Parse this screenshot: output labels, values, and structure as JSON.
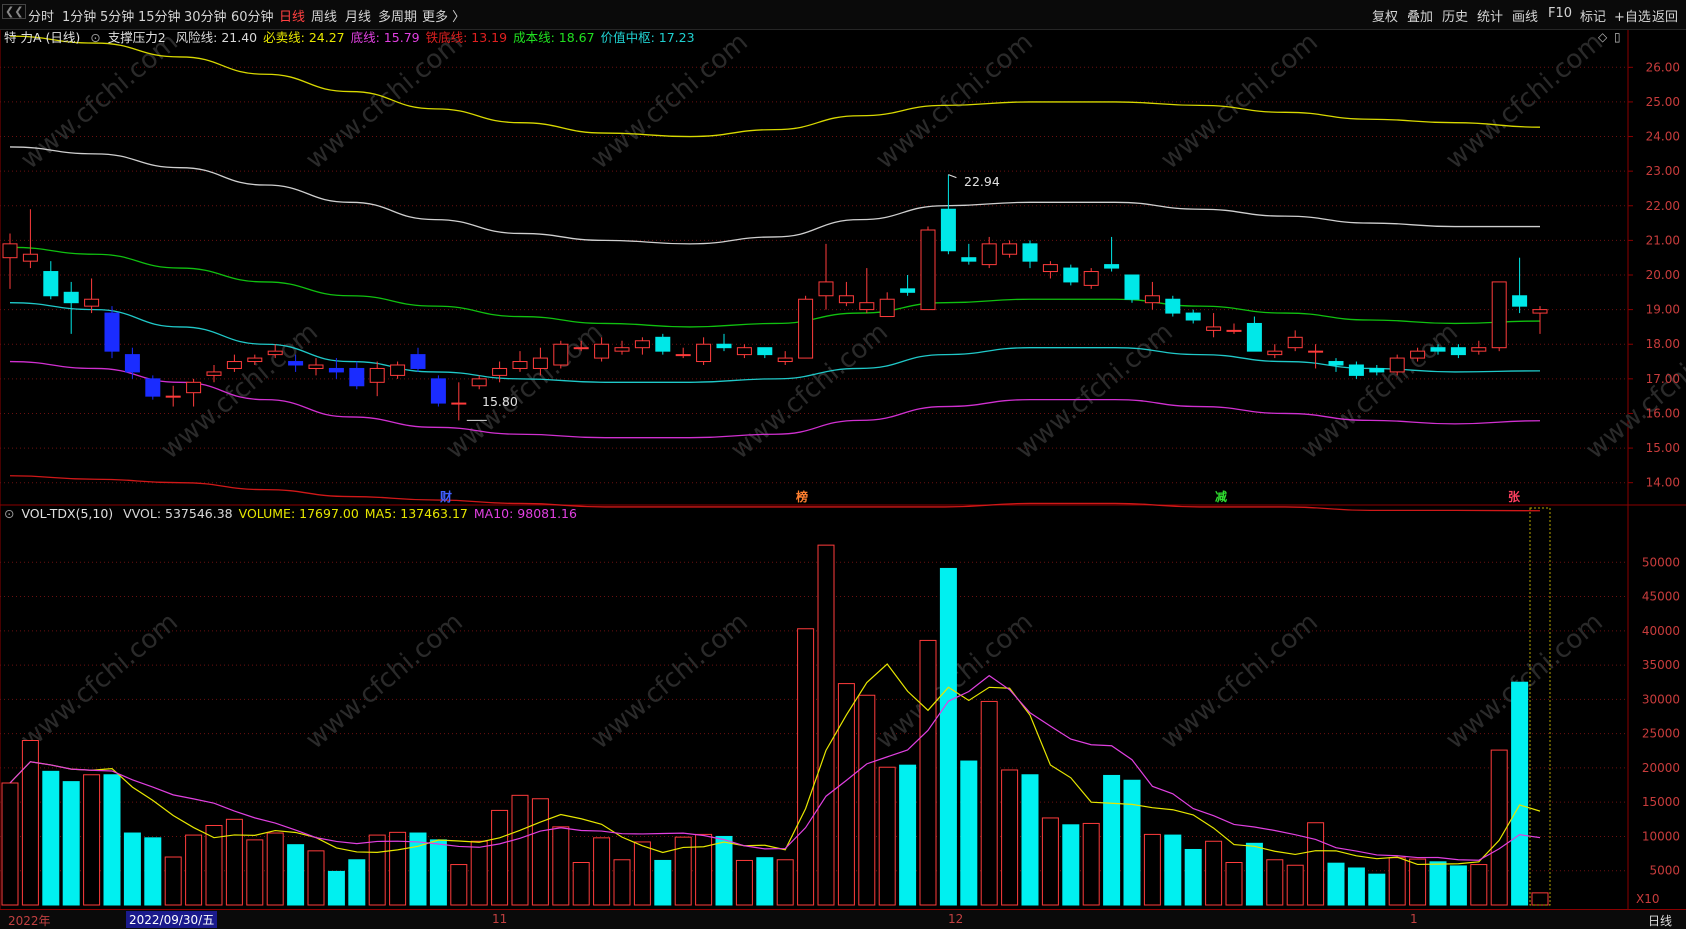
{
  "toolbar": {
    "periods": [
      "分时",
      "1分钟",
      "5分钟",
      "15分钟",
      "30分钟",
      "60分钟",
      "日线",
      "周线",
      "月线",
      "多周期",
      "更多 〉"
    ],
    "active_period": "日线",
    "right_tools": [
      "复权",
      "叠加",
      "历史",
      "统计",
      "画线",
      "F10",
      "标记",
      "+自选",
      "返回"
    ]
  },
  "indicator": {
    "stock": "特 力A (日线)",
    "name": "支撑压力2",
    "lines": [
      {
        "label": "风险线:",
        "value": "21.40",
        "color": "#d8d8d8"
      },
      {
        "label": "必卖线:",
        "value": "24.27",
        "color": "#e6e600"
      },
      {
        "label": "底线:",
        "value": "15.79",
        "color": "#e040e0"
      },
      {
        "label": "铁底线:",
        "value": "13.19",
        "color": "#e02020"
      },
      {
        "label": "成本线:",
        "value": "18.67",
        "color": "#20e020"
      },
      {
        "label": "价值中枢:",
        "value": "17.23",
        "color": "#20d0d0"
      }
    ]
  },
  "volume_indicator": {
    "name": "VOL-TDX(5,10)",
    "lines": [
      {
        "label": "VVOL:",
        "value": "537546.38",
        "color": "#d8d8d8"
      },
      {
        "label": "VOLUME:",
        "value": "17697.00",
        "color": "#e6e600"
      },
      {
        "label": "MA5:",
        "value": "137463.17",
        "color": "#e6e600"
      },
      {
        "label": "MA10:",
        "value": "98081.16",
        "color": "#e040e0"
      }
    ]
  },
  "price_axis": [
    "26.00",
    "25.00",
    "24.00",
    "23.00",
    "22.00",
    "21.00",
    "20.00",
    "19.00",
    "18.00",
    "17.00",
    "16.00",
    "15.00",
    "14.00"
  ],
  "volume_axis": [
    "50000",
    "45000",
    "40000",
    "35000",
    "30000",
    "25000",
    "20000",
    "15000",
    "10000",
    "5000"
  ],
  "volume_unit": "X10",
  "annotations": {
    "high": "22.94",
    "low": "15.80"
  },
  "events": [
    {
      "text": "财",
      "color": "#4060ff"
    },
    {
      "text": "榜",
      "color": "#ff8030"
    },
    {
      "text": "减",
      "color": "#30e030"
    },
    {
      "text": "张",
      "color": "#ff4060"
    }
  ],
  "date_axis": {
    "year": "2022年",
    "cursor_date": "2022/09/30/五",
    "months": [
      "11",
      "12",
      "1"
    ],
    "period": "日线"
  },
  "watermark": "www.cfchi.com",
  "chart_data": {
    "type": "candlestick",
    "ylim": [
      13.5,
      26.5
    ],
    "vol_ylim": [
      0,
      55000
    ],
    "candles": [
      {
        "o": 20.5,
        "c": 20.9,
        "h": 21.2,
        "l": 19.6,
        "v": 17800
      },
      {
        "o": 20.4,
        "c": 20.6,
        "h": 21.9,
        "l": 20.2,
        "v": 24000
      },
      {
        "o": 20.1,
        "c": 19.4,
        "h": 20.4,
        "l": 19.3,
        "v": 19500
      },
      {
        "o": 19.5,
        "c": 19.2,
        "h": 19.8,
        "l": 18.3,
        "v": 18000
      },
      {
        "o": 19.1,
        "c": 19.3,
        "h": 19.9,
        "l": 18.9,
        "v": 19000
      },
      {
        "o": 18.9,
        "c": 17.8,
        "h": 19.1,
        "l": 17.6,
        "v": 19000
      },
      {
        "o": 17.7,
        "c": 17.2,
        "h": 17.9,
        "l": 17.0,
        "v": 10500
      },
      {
        "o": 17.0,
        "c": 16.5,
        "h": 17.1,
        "l": 16.4,
        "v": 9800
      },
      {
        "o": 16.5,
        "c": 16.5,
        "h": 16.8,
        "l": 16.2,
        "v": 7000
      },
      {
        "o": 16.6,
        "c": 16.9,
        "h": 17.0,
        "l": 16.2,
        "v": 10200
      },
      {
        "o": 17.1,
        "c": 17.2,
        "h": 17.4,
        "l": 16.9,
        "v": 11600
      },
      {
        "o": 17.3,
        "c": 17.5,
        "h": 17.7,
        "l": 17.2,
        "v": 12500
      },
      {
        "o": 17.5,
        "c": 17.6,
        "h": 17.7,
        "l": 17.4,
        "v": 9500
      },
      {
        "o": 17.7,
        "c": 17.8,
        "h": 18.0,
        "l": 17.6,
        "v": 10500
      },
      {
        "o": 17.5,
        "c": 17.4,
        "h": 17.7,
        "l": 17.2,
        "v": 8800
      },
      {
        "o": 17.3,
        "c": 17.4,
        "h": 17.6,
        "l": 17.1,
        "v": 7900
      },
      {
        "o": 17.3,
        "c": 17.2,
        "h": 17.6,
        "l": 17.0,
        "v": 4900
      },
      {
        "o": 17.3,
        "c": 16.8,
        "h": 17.5,
        "l": 16.7,
        "v": 6600
      },
      {
        "o": 16.9,
        "c": 17.3,
        "h": 17.5,
        "l": 16.5,
        "v": 10200
      },
      {
        "o": 17.1,
        "c": 17.4,
        "h": 17.5,
        "l": 17.0,
        "v": 10600
      },
      {
        "o": 17.7,
        "c": 17.3,
        "h": 17.9,
        "l": 17.2,
        "v": 10500
      },
      {
        "o": 17.0,
        "c": 16.3,
        "h": 17.1,
        "l": 16.2,
        "v": 9500
      },
      {
        "o": 16.3,
        "c": 16.3,
        "h": 16.9,
        "l": 15.8,
        "v": 5900
      },
      {
        "o": 16.8,
        "c": 17.0,
        "h": 17.1,
        "l": 16.7,
        "v": 9300
      },
      {
        "o": 17.1,
        "c": 17.3,
        "h": 17.5,
        "l": 16.9,
        "v": 13800
      },
      {
        "o": 17.3,
        "c": 17.5,
        "h": 17.8,
        "l": 17.2,
        "v": 16000
      },
      {
        "o": 17.3,
        "c": 17.6,
        "h": 17.9,
        "l": 17.1,
        "v": 15500
      },
      {
        "o": 17.4,
        "c": 18.0,
        "h": 18.1,
        "l": 17.3,
        "v": 11400
      },
      {
        "o": 17.9,
        "c": 17.9,
        "h": 18.1,
        "l": 17.8,
        "v": 6200
      },
      {
        "o": 17.6,
        "c": 18.0,
        "h": 18.2,
        "l": 17.5,
        "v": 9800
      },
      {
        "o": 17.8,
        "c": 17.9,
        "h": 18.1,
        "l": 17.7,
        "v": 6600
      },
      {
        "o": 17.9,
        "c": 18.1,
        "h": 18.2,
        "l": 17.7,
        "v": 9200
      },
      {
        "o": 18.2,
        "c": 17.8,
        "h": 18.3,
        "l": 17.7,
        "v": 6500
      },
      {
        "o": 17.7,
        "c": 17.7,
        "h": 17.9,
        "l": 17.6,
        "v": 9900
      },
      {
        "o": 17.5,
        "c": 18.0,
        "h": 18.2,
        "l": 17.4,
        "v": 10300
      },
      {
        "o": 18.0,
        "c": 17.9,
        "h": 18.3,
        "l": 17.8,
        "v": 10000
      },
      {
        "o": 17.7,
        "c": 17.9,
        "h": 18.0,
        "l": 17.6,
        "v": 6500
      },
      {
        "o": 17.9,
        "c": 17.7,
        "h": 17.9,
        "l": 17.6,
        "v": 6900
      },
      {
        "o": 17.5,
        "c": 17.6,
        "h": 17.8,
        "l": 17.4,
        "v": 6600
      },
      {
        "o": 17.6,
        "c": 19.3,
        "h": 19.4,
        "l": 17.6,
        "v": 40300
      },
      {
        "o": 19.4,
        "c": 19.8,
        "h": 20.9,
        "l": 19.0,
        "v": 52500
      },
      {
        "o": 19.2,
        "c": 19.4,
        "h": 19.8,
        "l": 19.1,
        "v": 32300
      },
      {
        "o": 19.0,
        "c": 19.2,
        "h": 20.2,
        "l": 18.9,
        "v": 30600
      },
      {
        "o": 18.8,
        "c": 19.3,
        "h": 19.5,
        "l": 18.8,
        "v": 20100
      },
      {
        "o": 19.6,
        "c": 19.5,
        "h": 20.0,
        "l": 19.4,
        "v": 20400
      },
      {
        "o": 19.0,
        "c": 21.3,
        "h": 21.4,
        "l": 19.0,
        "v": 38600
      },
      {
        "o": 21.9,
        "c": 20.7,
        "h": 22.9,
        "l": 20.6,
        "v": 49100
      },
      {
        "o": 20.5,
        "c": 20.4,
        "h": 20.9,
        "l": 20.3,
        "v": 21000
      },
      {
        "o": 20.3,
        "c": 20.9,
        "h": 21.1,
        "l": 20.2,
        "v": 29700
      },
      {
        "o": 20.6,
        "c": 20.9,
        "h": 21.0,
        "l": 20.5,
        "v": 19700
      },
      {
        "o": 20.9,
        "c": 20.4,
        "h": 21.0,
        "l": 20.2,
        "v": 19000
      },
      {
        "o": 20.1,
        "c": 20.3,
        "h": 20.4,
        "l": 19.9,
        "v": 12700
      },
      {
        "o": 20.2,
        "c": 19.8,
        "h": 20.3,
        "l": 19.7,
        "v": 11700
      },
      {
        "o": 19.7,
        "c": 20.1,
        "h": 20.2,
        "l": 19.6,
        "v": 11900
      },
      {
        "o": 20.3,
        "c": 20.2,
        "h": 21.1,
        "l": 20.1,
        "v": 18900
      },
      {
        "o": 20.0,
        "c": 19.3,
        "h": 20.0,
        "l": 19.2,
        "v": 18200
      },
      {
        "o": 19.2,
        "c": 19.4,
        "h": 19.8,
        "l": 19.0,
        "v": 10300
      },
      {
        "o": 19.3,
        "c": 18.9,
        "h": 19.4,
        "l": 18.8,
        "v": 10200
      },
      {
        "o": 18.9,
        "c": 18.7,
        "h": 19.0,
        "l": 18.6,
        "v": 8100
      },
      {
        "o": 18.4,
        "c": 18.5,
        "h": 18.9,
        "l": 18.2,
        "v": 9300
      },
      {
        "o": 18.4,
        "c": 18.4,
        "h": 18.6,
        "l": 18.3,
        "v": 6200
      },
      {
        "o": 18.6,
        "c": 17.8,
        "h": 18.8,
        "l": 17.8,
        "v": 9000
      },
      {
        "o": 17.7,
        "c": 17.8,
        "h": 18.0,
        "l": 17.6,
        "v": 6600
      },
      {
        "o": 17.9,
        "c": 18.2,
        "h": 18.4,
        "l": 17.8,
        "v": 5800
      },
      {
        "o": 17.8,
        "c": 17.8,
        "h": 18.0,
        "l": 17.3,
        "v": 12000
      },
      {
        "o": 17.5,
        "c": 17.4,
        "h": 17.6,
        "l": 17.2,
        "v": 6100
      },
      {
        "o": 17.4,
        "c": 17.1,
        "h": 17.5,
        "l": 17.0,
        "v": 5400
      },
      {
        "o": 17.3,
        "c": 17.2,
        "h": 17.4,
        "l": 17.1,
        "v": 4500
      },
      {
        "o": 17.2,
        "c": 17.6,
        "h": 17.7,
        "l": 17.1,
        "v": 6900
      },
      {
        "o": 17.6,
        "c": 17.8,
        "h": 17.9,
        "l": 17.5,
        "v": 6700
      },
      {
        "o": 17.9,
        "c": 17.8,
        "h": 18.0,
        "l": 17.7,
        "v": 6300
      },
      {
        "o": 17.9,
        "c": 17.7,
        "h": 18.0,
        "l": 17.6,
        "v": 5700
      },
      {
        "o": 17.8,
        "c": 17.9,
        "h": 18.1,
        "l": 17.7,
        "v": 5900
      },
      {
        "o": 17.9,
        "c": 19.8,
        "h": 19.8,
        "l": 17.8,
        "v": 22600
      },
      {
        "o": 19.4,
        "c": 19.1,
        "h": 20.5,
        "l": 18.9,
        "v": 32500
      },
      {
        "o": 18.9,
        "c": 19.0,
        "h": 19.1,
        "l": 18.3,
        "v": 1770
      }
    ],
    "lines": [
      {
        "name": "必卖线",
        "color": "#d8d800",
        "values": [
          26.9,
          26.7,
          26.3,
          25.8,
          25.3,
          24.8,
          24.4,
          24.1,
          24.0,
          24.2,
          24.6,
          24.9,
          25.0,
          25.0,
          24.9,
          24.7,
          24.5,
          24.4,
          24.27
        ]
      },
      {
        "name": "风险线",
        "color": "#cfcfcf",
        "values": [
          23.7,
          23.5,
          23.1,
          22.6,
          22.1,
          21.6,
          21.2,
          21.0,
          20.9,
          21.1,
          21.6,
          22.0,
          22.1,
          22.1,
          21.9,
          21.7,
          21.5,
          21.4,
          21.4
        ]
      },
      {
        "name": "成本线",
        "color": "#10c010",
        "values": [
          20.8,
          20.6,
          20.2,
          19.8,
          19.4,
          19.1,
          18.8,
          18.6,
          18.5,
          18.6,
          18.9,
          19.2,
          19.3,
          19.3,
          19.1,
          18.9,
          18.7,
          18.6,
          18.67
        ]
      },
      {
        "name": "价值中枢",
        "color": "#20c8c8",
        "values": [
          19.2,
          19.0,
          18.5,
          18.0,
          17.5,
          17.2,
          17.0,
          16.9,
          16.9,
          17.0,
          17.3,
          17.7,
          17.9,
          17.9,
          17.7,
          17.5,
          17.3,
          17.2,
          17.23
        ]
      },
      {
        "name": "底线",
        "color": "#d030d0",
        "values": [
          17.5,
          17.3,
          16.9,
          16.4,
          15.9,
          15.6,
          15.4,
          15.3,
          15.3,
          15.4,
          15.8,
          16.2,
          16.4,
          16.4,
          16.2,
          16.0,
          15.8,
          15.7,
          15.79
        ]
      },
      {
        "name": "铁底线",
        "color": "#d01818",
        "values": [
          14.2,
          14.1,
          14.0,
          13.8,
          13.6,
          13.5,
          13.4,
          13.3,
          13.3,
          13.3,
          13.3,
          13.3,
          13.4,
          13.4,
          13.3,
          13.3,
          13.2,
          13.2,
          13.19
        ]
      }
    ]
  }
}
